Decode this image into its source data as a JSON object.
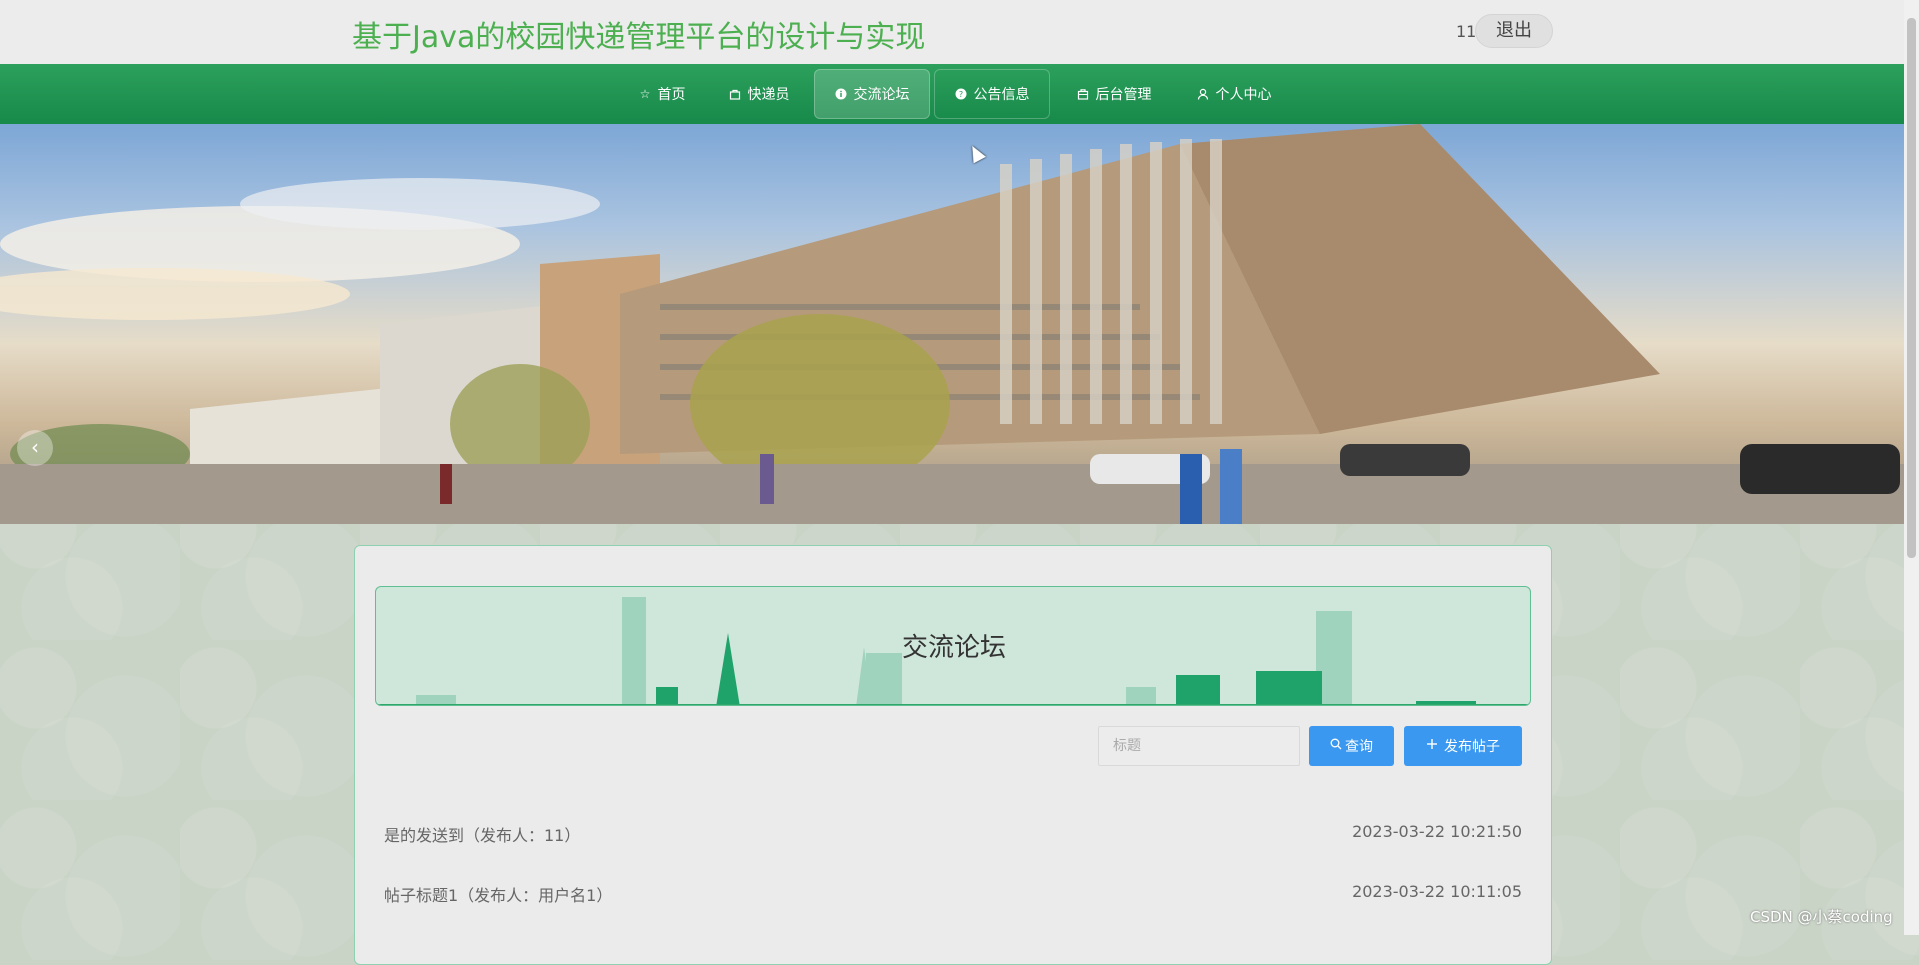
{
  "header": {
    "site_title": "基于Java的校园快递管理平台的设计与实现",
    "user_name": "11",
    "logout_label": "退出"
  },
  "nav": {
    "items": [
      {
        "label": "首页",
        "icon": "star-icon"
      },
      {
        "label": "快递员",
        "icon": "bag-icon"
      },
      {
        "label": "交流论坛",
        "icon": "info-icon"
      },
      {
        "label": "公告信息",
        "icon": "question-icon"
      },
      {
        "label": "后台管理",
        "icon": "briefcase-icon"
      },
      {
        "label": "个人中心",
        "icon": "user-icon"
      }
    ],
    "active_index": 2
  },
  "carousel": {
    "prev_label": "‹",
    "slide_count": 3,
    "active_slide": 0
  },
  "forum": {
    "title": "交流论坛",
    "search_placeholder": "标题",
    "query_label": "查询",
    "post_label": "发布帖子",
    "posts": [
      {
        "title": "是的发送到（发布人：11）",
        "time": "2023-03-22 10:21:50"
      },
      {
        "title": "帖子标题1（发布人：用户名1）",
        "time": "2023-03-22 10:11:05"
      }
    ]
  },
  "watermark": "CSDN @小蔡coding",
  "colors": {
    "nav_green": "#1e9452",
    "title_green": "#4caf50",
    "button_blue": "#3a98f0"
  }
}
